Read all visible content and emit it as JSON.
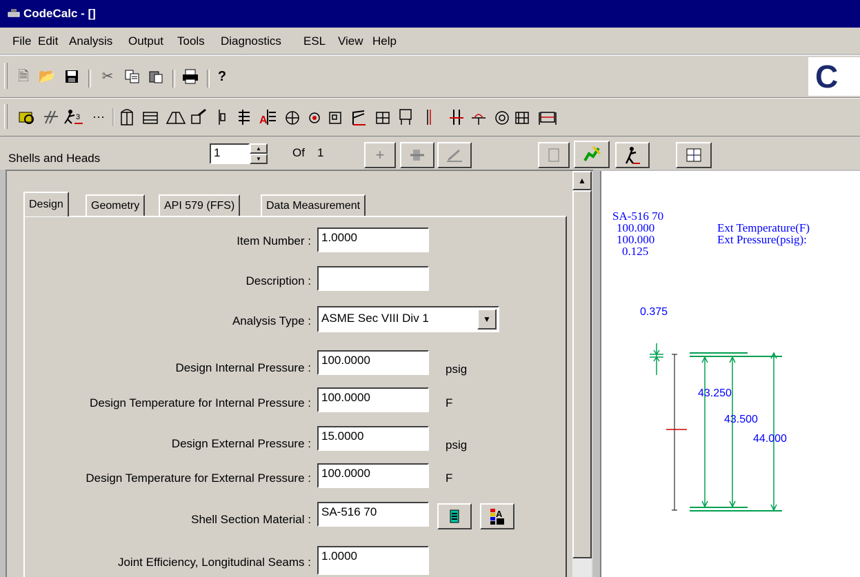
{
  "window": {
    "title": "CodeCalc - []"
  },
  "menu": [
    {
      "label": "File"
    },
    {
      "label": "Edit"
    },
    {
      "label": "Analysis"
    },
    {
      "label": "Output"
    },
    {
      "label": "Tools"
    },
    {
      "label": "Diagnostics"
    },
    {
      "label": "ESL"
    },
    {
      "label": "View"
    },
    {
      "label": "Help"
    }
  ],
  "toolbar1": {
    "logo_text": "C",
    "icons": [
      "new-icon",
      "open-icon",
      "save-icon",
      "cut-icon",
      "copy-icon",
      "paste-icon",
      "print-icon",
      "help-icon"
    ]
  },
  "toolbar2": {
    "icons": [
      "find-icon",
      "tool-icon",
      "walker-icon",
      "ellipsis-icon",
      "shell-icon",
      "head-icon",
      "cone-icon",
      "nozzle-icon",
      "flange-icon",
      "tubesheet-icon",
      "tubesheet-red-icon",
      "pipe-icon",
      "circle-plus-icon",
      "square-icon",
      "saddle-icon",
      "lug-icon",
      "leg-icon",
      "line-icon",
      "red-line-icon",
      "ring-icon",
      "target-icon",
      "expansion-icon",
      "horizontal-vessel-icon"
    ]
  },
  "nav": {
    "module_label": "Shells and Heads",
    "current_item": "1",
    "of_label": "Of",
    "total": "1",
    "add_symbol": "+"
  },
  "tabs": [
    {
      "label": "Design"
    },
    {
      "label": "Geometry"
    },
    {
      "label": "API 579 (FFS)"
    },
    {
      "label": "Data Measurement"
    }
  ],
  "form": {
    "item_number": {
      "label": "Item Number :",
      "value": "1.0000"
    },
    "description": {
      "label": "Description :",
      "value": ""
    },
    "analysis_type": {
      "label": "Analysis Type :",
      "value": "ASME Sec VIII Div 1"
    },
    "design_internal_pressure": {
      "label": "Design Internal Pressure :",
      "value": "100.0000",
      "unit": "psig"
    },
    "design_temp_internal": {
      "label": "Design Temperature for Internal Pressure :",
      "value": "100.0000",
      "unit": "F"
    },
    "design_external_pressure": {
      "label": "Design External Pressure :",
      "value": "15.0000",
      "unit": "psig"
    },
    "design_temp_external": {
      "label": "Design Temperature for External Pressure :",
      "value": "100.0000",
      "unit": "F"
    },
    "shell_material": {
      "label": "Shell Section Material :",
      "value": "SA-516 70"
    },
    "joint_efficiency": {
      "label": "Joint Efficiency, Longitudinal Seams :",
      "value": "1.0000"
    }
  },
  "drawing": {
    "material": "SA-516 70",
    "v1": "100.000",
    "v2": "100.000",
    "v3": "0.125",
    "ext_temp_label": "Ext Temperature(F)",
    "ext_press_label": "Ext Pressure(psig):",
    "thickness": "0.375",
    "dim1": "43.250",
    "dim2": "43.500",
    "dim3": "44.000"
  },
  "colors": {
    "title_bar": "#00007a",
    "drawing_text": "#0000ff",
    "dimension_lines": "#00a050",
    "centerline": "#cc0000"
  }
}
